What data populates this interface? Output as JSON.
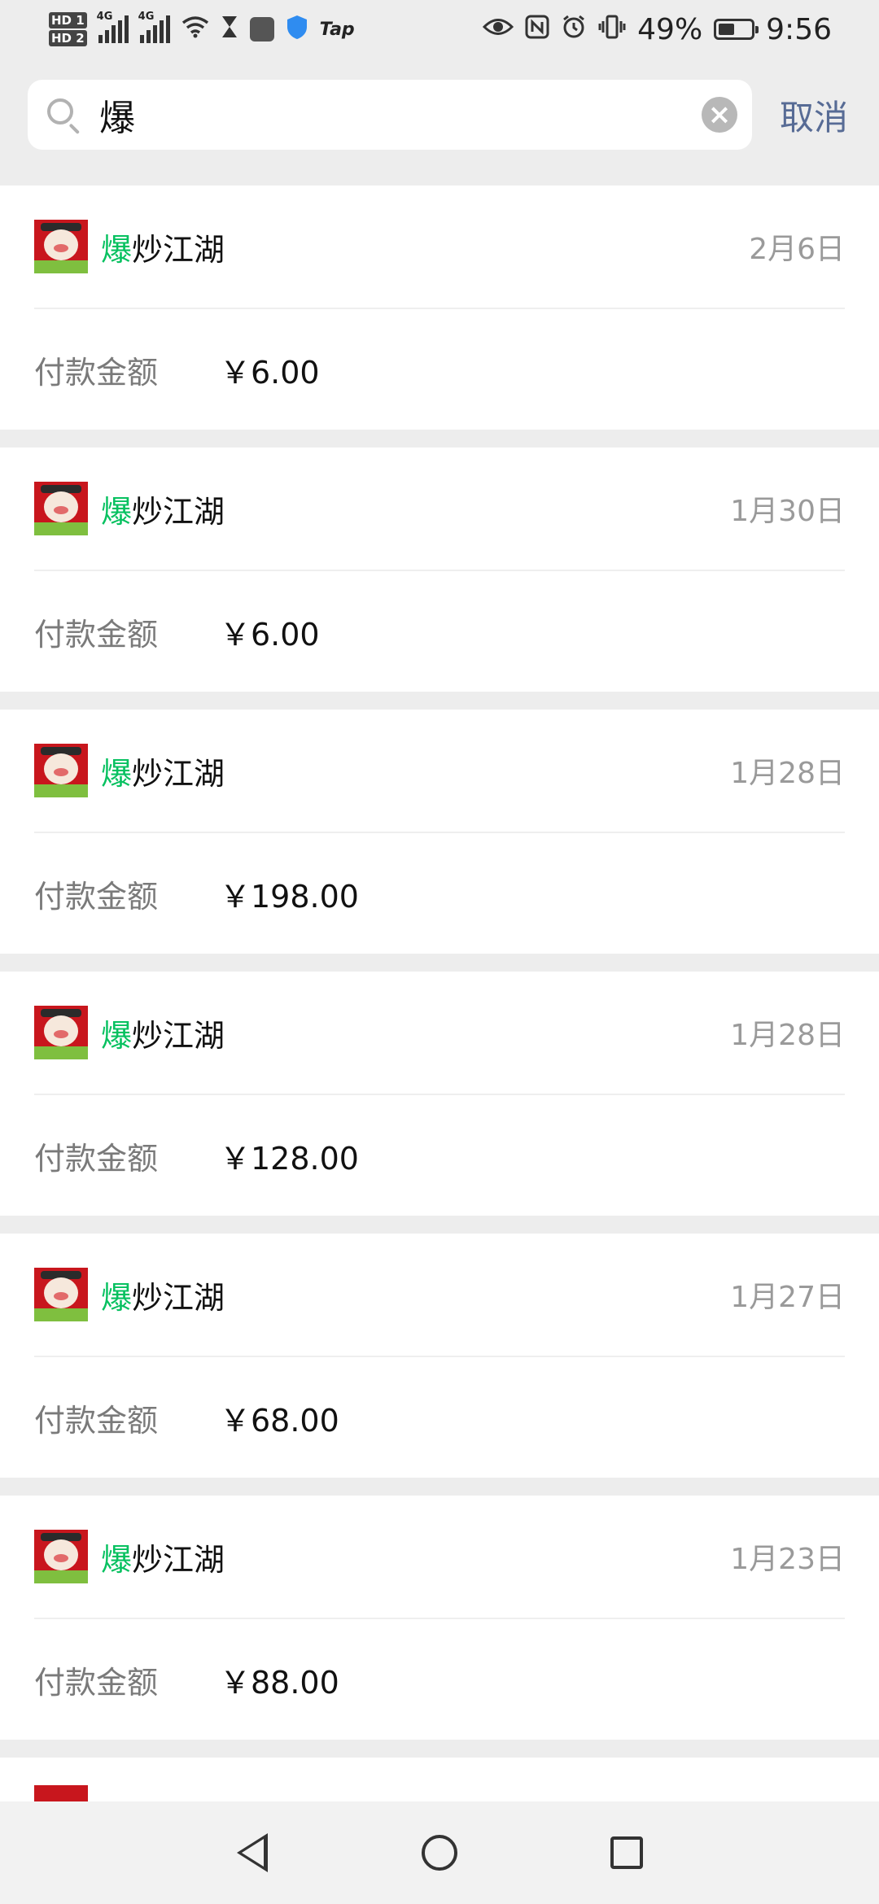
{
  "status_bar": {
    "hd1": "HD 1",
    "hd2": "HD 2",
    "sim1_net": "4G",
    "sim2_net": "4G",
    "tap_label": "Tap",
    "battery_percent": "49%",
    "battery_level": 0.49,
    "time": "9:56"
  },
  "search": {
    "query": "爆",
    "placeholder": "",
    "cancel_label": "取消"
  },
  "results": [
    {
      "name_highlight": "爆",
      "name_rest": "炒江湖",
      "date": "2月6日",
      "amount_label": "付款金额",
      "amount": "￥6.00"
    },
    {
      "name_highlight": "爆",
      "name_rest": "炒江湖",
      "date": "1月30日",
      "amount_label": "付款金额",
      "amount": "￥6.00"
    },
    {
      "name_highlight": "爆",
      "name_rest": "炒江湖",
      "date": "1月28日",
      "amount_label": "付款金额",
      "amount": "￥198.00"
    },
    {
      "name_highlight": "爆",
      "name_rest": "炒江湖",
      "date": "1月28日",
      "amount_label": "付款金额",
      "amount": "￥128.00"
    },
    {
      "name_highlight": "爆",
      "name_rest": "炒江湖",
      "date": "1月27日",
      "amount_label": "付款金额",
      "amount": "￥68.00"
    },
    {
      "name_highlight": "爆",
      "name_rest": "炒江湖",
      "date": "1月23日",
      "amount_label": "付款金额",
      "amount": "￥88.00"
    }
  ],
  "colors": {
    "highlight": "#07c160",
    "cancel": "#576b95",
    "background": "#ededed"
  },
  "icons": {
    "search": "search-icon",
    "clear": "clear-icon",
    "nav_back": "back-icon",
    "nav_home": "home-icon",
    "nav_recent": "recent-apps-icon"
  }
}
